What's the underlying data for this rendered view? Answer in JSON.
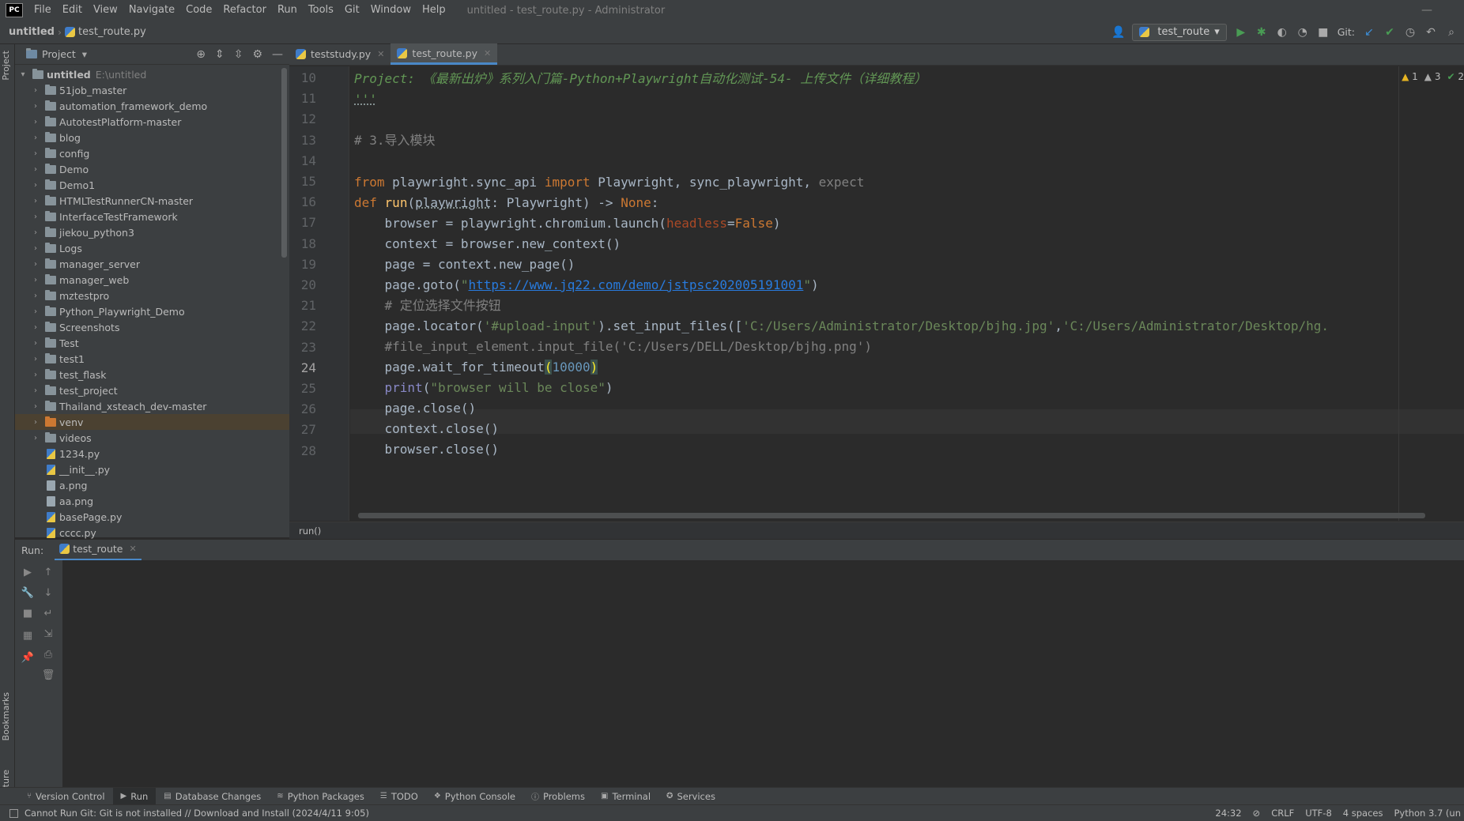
{
  "app": {
    "logo": "PC",
    "window_title": "untitled - test_route.py - Administrator",
    "menu": [
      "File",
      "Edit",
      "View",
      "Navigate",
      "Code",
      "Refactor",
      "Run",
      "Tools",
      "Git",
      "Window",
      "Help"
    ]
  },
  "navbar": {
    "project": "untitled",
    "file": "test_route.py",
    "run_config": "test_route",
    "git_label": "Git:"
  },
  "project_panel": {
    "title": "Project",
    "root": "untitled",
    "root_path": "E:\\untitled",
    "items": [
      {
        "label": "51job_master",
        "kind": "folder"
      },
      {
        "label": "automation_framework_demo",
        "kind": "folder"
      },
      {
        "label": "AutotestPlatform-master",
        "kind": "folder"
      },
      {
        "label": "blog",
        "kind": "folder"
      },
      {
        "label": "config",
        "kind": "folder"
      },
      {
        "label": "Demo",
        "kind": "folder"
      },
      {
        "label": "Demo1",
        "kind": "folder"
      },
      {
        "label": "HTMLTestRunnerCN-master",
        "kind": "folder"
      },
      {
        "label": "InterfaceTestFramework",
        "kind": "folder"
      },
      {
        "label": "jiekou_python3",
        "kind": "folder"
      },
      {
        "label": "Logs",
        "kind": "folder"
      },
      {
        "label": "manager_server",
        "kind": "folder"
      },
      {
        "label": "manager_web",
        "kind": "folder"
      },
      {
        "label": "mztestpro",
        "kind": "folder"
      },
      {
        "label": "Python_Playwright_Demo",
        "kind": "folder"
      },
      {
        "label": "Screenshots",
        "kind": "folder"
      },
      {
        "label": "Test",
        "kind": "folder"
      },
      {
        "label": "test1",
        "kind": "folder"
      },
      {
        "label": "test_flask",
        "kind": "folder"
      },
      {
        "label": "test_project",
        "kind": "folder"
      },
      {
        "label": "Thailand_xsteach_dev-master",
        "kind": "folder"
      },
      {
        "label": "venv",
        "kind": "folder-excluded"
      },
      {
        "label": "videos",
        "kind": "folder"
      },
      {
        "label": "1234.py",
        "kind": "py"
      },
      {
        "label": "__init__.py",
        "kind": "py"
      },
      {
        "label": "a.png",
        "kind": "img"
      },
      {
        "label": "aa.png",
        "kind": "img"
      },
      {
        "label": "basePage.py",
        "kind": "py"
      },
      {
        "label": "cccc.py",
        "kind": "py"
      }
    ]
  },
  "editor": {
    "tabs": [
      {
        "label": "teststudy.py",
        "active": false
      },
      {
        "label": "test_route.py",
        "active": true
      }
    ],
    "line_numbers": [
      "10",
      "11",
      "12",
      "13",
      "14",
      "15",
      "16",
      "17",
      "18",
      "19",
      "20",
      "21",
      "22",
      "23",
      "24",
      "25",
      "26",
      "27",
      "28"
    ],
    "current_line": "24",
    "inspections": {
      "warnings": "1",
      "weak_warnings": "3",
      "ok": "2"
    },
    "breadcrumb": "run()",
    "lines": {
      "l10": "Project: 《最新出炉》系列入门篇-Python+Playwright自动化测试-54- 上传文件（详细教程）",
      "l11": "'''",
      "l13": "# 3.导入模块",
      "l15_from": "from",
      "l15_mod": " playwright.sync_api ",
      "l15_import": "import",
      "l15_names": " Playwright, sync_playwright,",
      "l15_unused": " expect",
      "l16_def": "def",
      "l16_fn": "run",
      "l16_param": "playwright",
      "l16_rest": ": Playwright) -> ",
      "l16_none": "None",
      "l16_colon": ":",
      "l17_a": "    browser = playwright.chromium.launch(",
      "l17_kw": "headless",
      "l17_eq": "=",
      "l17_false": "False",
      "l17_close": ")",
      "l18": "    context = browser.new_context()",
      "l19": "    page = context.new_page()",
      "l20_a": "    page.goto(",
      "l20_q1": "\"",
      "l20_url": "https://www.jq22.com/demo/jstpsc202005191001",
      "l20_q2": "\"",
      "l20_close": ")",
      "l21": "    # 定位选择文件按钮",
      "l22_a": "    page.locator(",
      "l22_sel": "'#upload-input'",
      "l22_b": ").set_input_files([",
      "l22_p1": "'C:/Users/Administrator/Desktop/bjhg.jpg'",
      "l22_c": ",",
      "l22_p2": "'C:/Users/Administrator/Desktop/hg.",
      "l23": "    #file_input_element.input_file('C:/Users/DELL/Desktop/bjhg.png')",
      "l24_a": "    page.wait_for_timeout",
      "l24_open": "(",
      "l24_num": "10000",
      "l24_close": ")",
      "l25_print": "print",
      "l25_open": "(",
      "l25_str": "\"browser will be close\"",
      "l25_close": ")",
      "l26": "    page.close()",
      "l27": "    context.close()",
      "l28": "    browser.close()"
    }
  },
  "run_panel": {
    "label": "Run:",
    "tab": "test_route"
  },
  "left_stripe": {
    "project": "Project",
    "bookmarks": "Bookmarks",
    "structure": "Structure"
  },
  "bottom_tools": [
    "Version Control",
    "Run",
    "Database Changes",
    "Python Packages",
    "TODO",
    "Python Console",
    "Problems",
    "Terminal",
    "Services"
  ],
  "status": {
    "message": "Cannot Run Git: Git is not installed // Download and Install (2024/4/11 9:05)",
    "position": "24:32",
    "line_sep": "CRLF",
    "encoding": "UTF-8",
    "indent": "4 spaces",
    "interpreter": "Python 3.7 (un"
  }
}
